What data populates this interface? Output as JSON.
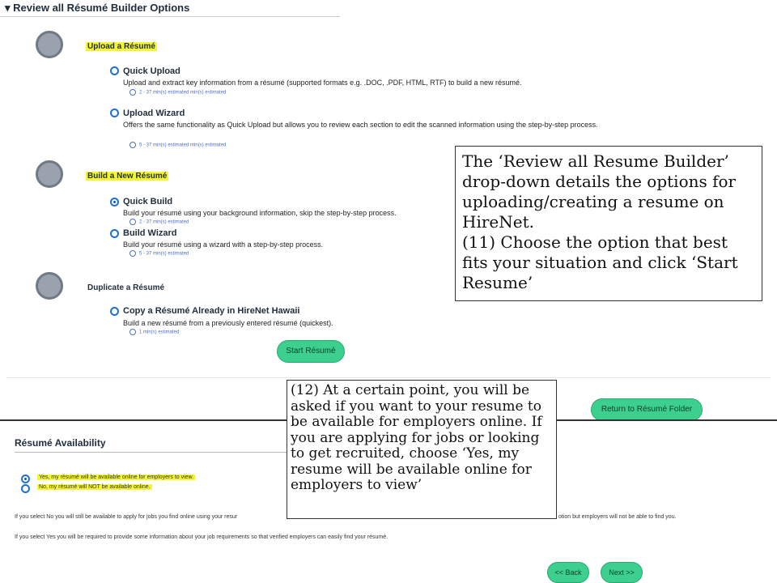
{
  "builder": {
    "header": "Review all Résumé Builder Options",
    "sections": [
      {
        "title": "Upload a Résumé",
        "options": [
          {
            "title": "Quick Upload",
            "desc": "Upload and extract key information from a résumé (supported formats e.g. .DOC, .PDF, HTML, RTF) to build a new résumé.",
            "time": "2 - 37 min(s) estimated min(s) estimated"
          },
          {
            "title": "Upload Wizard",
            "desc": "Offers the same functionality as Quick Upload but allows you to review each section to edit the scanned information using the step-by-step process.",
            "time": "5 - 37 min(s) estimated min(s) estimated"
          }
        ]
      },
      {
        "title": "Build a New Résumé",
        "options": [
          {
            "title": "Quick Build",
            "desc": "Build your résumé using your background information, skip the step-by-step process.",
            "time": "2 - 37 min(s) estimated"
          },
          {
            "title": "Build Wizard",
            "desc": "Build your résumé using a wizard with a step-by-step process.",
            "time": "5 - 37 min(s) estimated"
          }
        ]
      },
      {
        "title": "Duplicate a Résumé",
        "options": [
          {
            "title": "Copy a Résumé Already in HireNet Hawaii",
            "desc": "Build a new résumé from a previously entered résumé (quickest).",
            "time": "1 min(s) estimated"
          }
        ]
      }
    ],
    "start_button": "Start Résumé",
    "return_button": "Return to Résumé Folder"
  },
  "availability": {
    "title": "Résumé Availability",
    "yes_label": "Yes, my résumé will be available online for employers to view.",
    "no_label": "No, my résumé will NOT be available online.",
    "note_no_left": "If you select No you will still be available to apply for jobs you find online using your resur",
    "note_no_right": "otion but employers will not be able to find you.",
    "note_yes": "If you select Yes you will be required to provide some information about your job requirements so that verified employers can easily find your résumé.",
    "back_button": "<< Back",
    "next_button": "Next >>"
  },
  "callouts": {
    "one": "The ‘Review all Resume Builder’ drop-down details the options for uploading/creating a resume on HireNet.\n(11) Choose the option that best fits your situation and click ‘Start Resume’",
    "two": "(12) At a certain point, you will be asked if you want to your resume to be available for employers online. If you are applying for jobs or looking to get recruited, choose ‘Yes, my resume will be available online for employers to view’"
  },
  "colors": {
    "accent_green": "#3ccf8e",
    "highlight": "#f5f530",
    "radio_blue": "#1f6fd1"
  }
}
